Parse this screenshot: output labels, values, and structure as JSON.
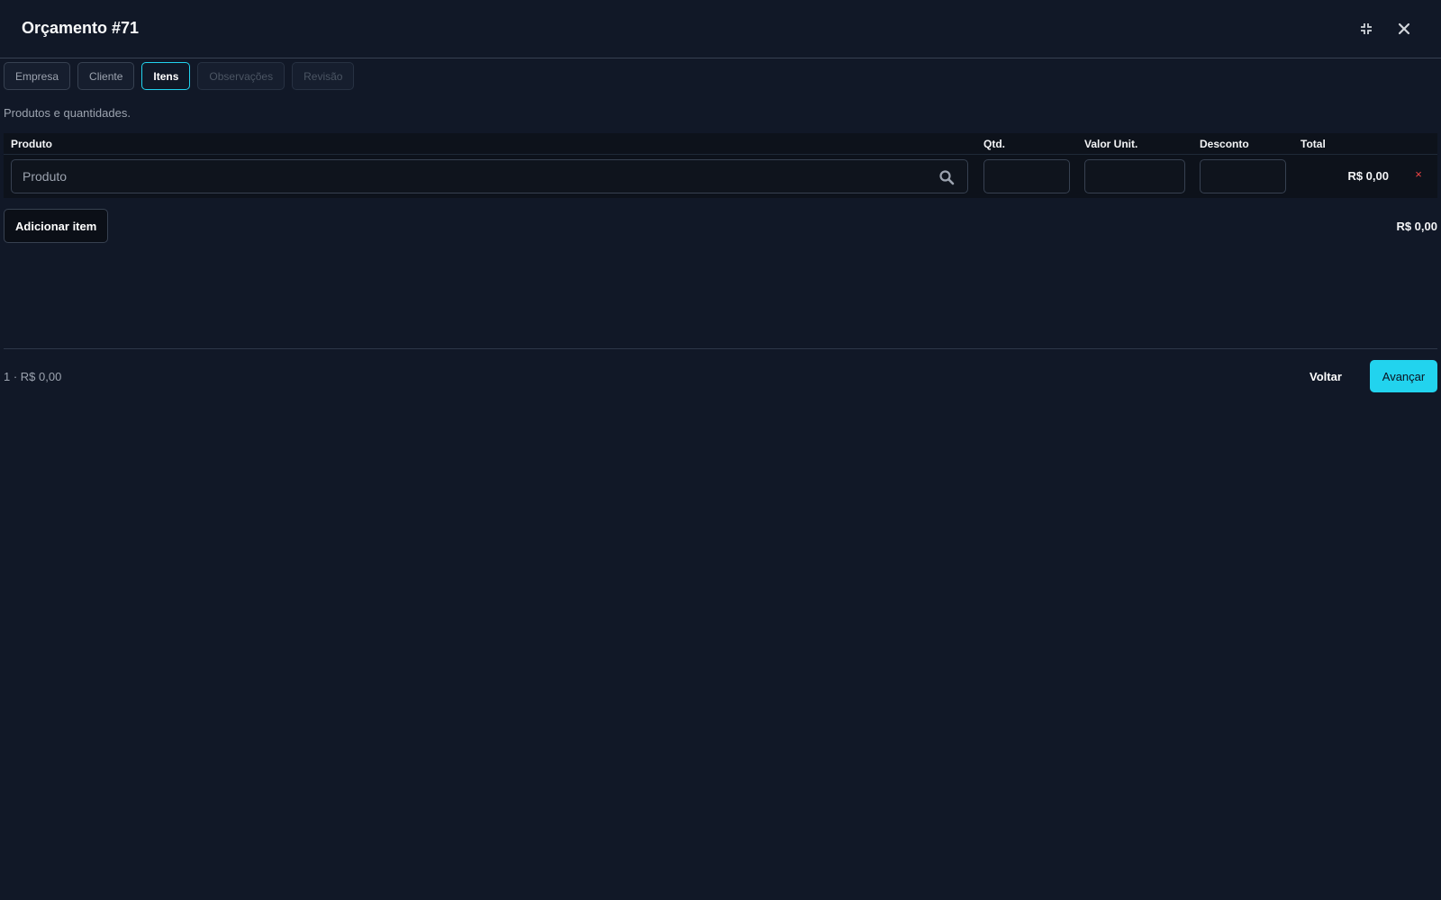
{
  "header": {
    "title": "Orçamento #71",
    "minimize_icon": "minimize-icon",
    "close_icon": "close-icon"
  },
  "tabs": [
    {
      "label": "Empresa",
      "state": "normal"
    },
    {
      "label": "Cliente",
      "state": "normal"
    },
    {
      "label": "Itens",
      "state": "active"
    },
    {
      "label": "Observações",
      "state": "disabled"
    },
    {
      "label": "Revisão",
      "state": "disabled"
    }
  ],
  "section": {
    "subtitle": "Produtos e quantidades."
  },
  "table": {
    "columns": [
      "Produto",
      "Qtd.",
      "Valor Unit.",
      "Desconto",
      "Total"
    ],
    "rows": [
      {
        "product_placeholder": "Produto",
        "product_value": "",
        "qty": "",
        "unit_value": "",
        "discount": "",
        "total": "R$ 0,00",
        "remove_label": "×"
      }
    ]
  },
  "actions": {
    "add_item_label": "Adicionar item",
    "grand_total": "R$ 0,00"
  },
  "footer": {
    "summary": "1 · R$ 0,00",
    "back_label": "Voltar",
    "next_label": "Avançar"
  },
  "colors": {
    "background": "#111827",
    "accent": "#22d3ee",
    "danger": "#ef4444"
  }
}
